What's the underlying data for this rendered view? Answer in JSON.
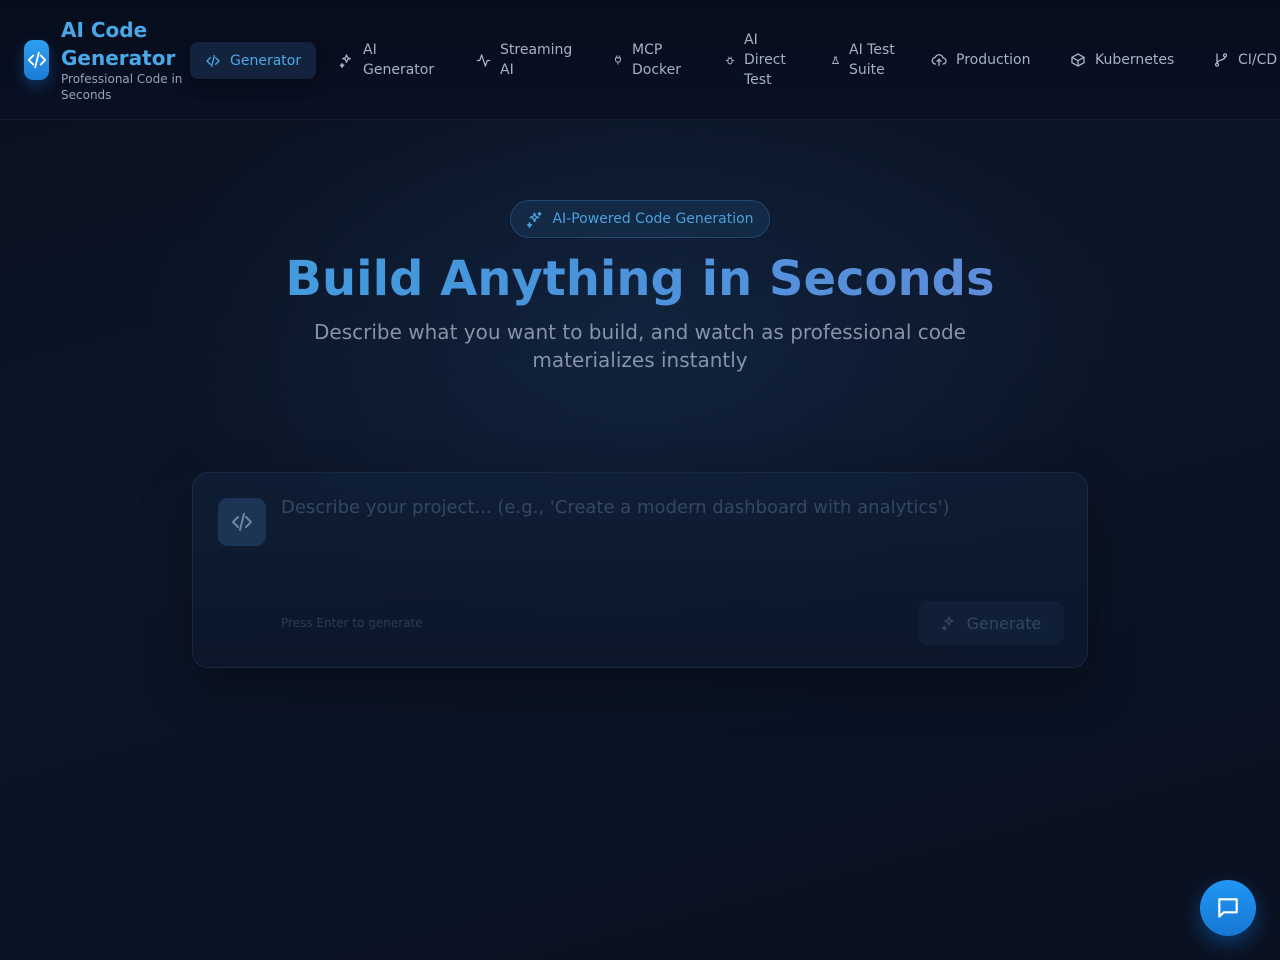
{
  "brand": {
    "title": "AI Code Generator",
    "subtitle": "Professional Code in Seconds",
    "icon": "code-icon"
  },
  "nav": {
    "items": [
      {
        "label": "Generator",
        "icon": "code-icon",
        "active": true
      },
      {
        "label": "AI Generator",
        "icon": "sparkles-icon",
        "active": false
      },
      {
        "label": "Streaming AI",
        "icon": "activity-icon",
        "active": false
      },
      {
        "label": "MCP Docker",
        "icon": "plug-icon",
        "active": false
      },
      {
        "label": "AI Direct Test",
        "icon": "bug-icon",
        "active": false
      },
      {
        "label": "AI Test Suite",
        "icon": "flask-icon",
        "active": false
      },
      {
        "label": "Production",
        "icon": "cloud-upload-icon",
        "active": false
      },
      {
        "label": "Kubernetes",
        "icon": "box-icon",
        "active": false
      },
      {
        "label": "CI/CD",
        "icon": "git-branch-icon",
        "active": false
      }
    ]
  },
  "hero": {
    "badge": "AI-Powered Code Generation",
    "title": "Build Anything in Seconds",
    "subtitle": "Describe what you want to build, and watch as professional code materializes instantly"
  },
  "prompt": {
    "value": "",
    "placeholder": "Describe your project... (e.g., 'Create a modern dashboard with analytics')",
    "hint": "Press Enter to generate",
    "button_label": "Generate"
  },
  "chat": {
    "icon": "chat-bubble-icon"
  },
  "colors": {
    "accent": "#4aa8e8",
    "brand_blue": "#2196f3",
    "background": "#0a1222"
  }
}
